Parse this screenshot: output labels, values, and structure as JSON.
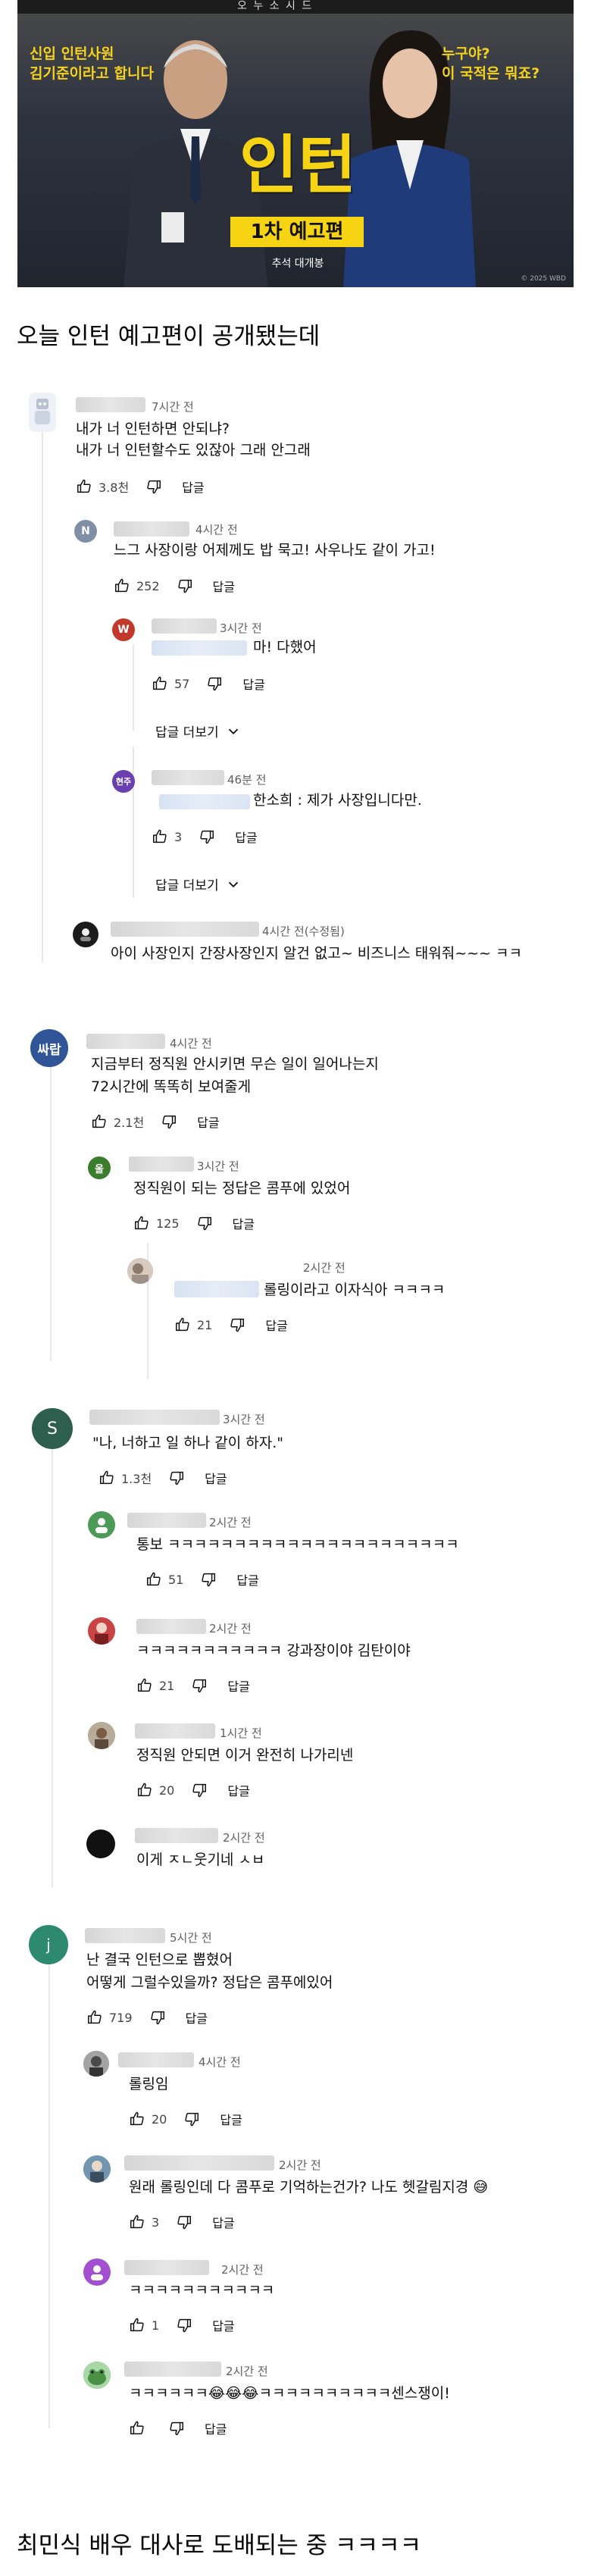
{
  "poster": {
    "top_band": "오 누 소 시 드",
    "left_text": [
      "신입 인턴사원",
      "김기준이라고 합니다"
    ],
    "right_text": [
      "누구야?",
      "이 국적은 뭐죠?"
    ],
    "title": "인턴",
    "subtitle": "1차 예고편",
    "release": "추석 대개봉",
    "mark": "© 2025 WBD"
  },
  "heading_top": "오늘 인턴 예고편이 공개됐는데",
  "heading_bottom": "최민식 배우 대사로 도배되는 중 ㅋㅋㅋㅋ",
  "comments": {
    "c1": {
      "time": "7시간 전",
      "lines": [
        "내가 너 인턴하면 안되냐?",
        "내가 너 인턴할수도 있잖아 그래 안그래"
      ],
      "likes": "3.8천",
      "reply": "답글"
    },
    "c1r1": {
      "avatar": "N",
      "time": "4시간 전",
      "lines": [
        "느그 사장이랑 어제께도 밥 묵고! 사우나도 같이 가고!"
      ],
      "likes": "252",
      "reply": "답글"
    },
    "c1r2": {
      "avatar": "W",
      "time": "3시간 전",
      "lines": [
        "마! 다했어"
      ],
      "likes": "57",
      "reply": "답글"
    },
    "c1r2_more": "답글 더보기",
    "c1r3": {
      "avatar": "현주",
      "time": "46분 전",
      "lines": [
        "한소희 : 제가 사장입니다만."
      ],
      "likes": "3",
      "reply": "답글"
    },
    "c1r3_more": "답글 더보기",
    "c1r4": {
      "time": "4시간 전(수정됨)",
      "lines": [
        "아이 사장인지 간장사장인지 알건 없고~ 비즈니스 태워줘~~~ ㅋㅋ"
      ]
    },
    "c2": {
      "avatar": "싸랍",
      "time": "4시간 전",
      "lines": [
        "지금부터 정직원 안시키면 무슨 일이 일어나는지",
        "72시간에 똑똑히 보여줄게"
      ],
      "likes": "2.1천",
      "reply": "답글"
    },
    "c2r1": {
      "avatar": "울",
      "time": "3시간 전",
      "lines": [
        "정직원이 되는 정답은 콤푸에 있었어"
      ],
      "likes": "125",
      "reply": "답글"
    },
    "c2r2": {
      "time": "2시간 전",
      "lines": [
        "롤링이라고 이자식아 ㅋㅋㅋㅋ"
      ],
      "likes": "21",
      "reply": "답글"
    },
    "c3": {
      "avatar": "S",
      "time": "3시간 전",
      "lines": [
        "\"나, 너하고 일 하나 같이 하자.\""
      ],
      "likes": "1.3천",
      "reply": "답글"
    },
    "c3r1": {
      "time": "2시간 전",
      "lines": [
        "통보 ㅋㅋㅋㅋㅋㅋㅋㅋㅋㅋㅋㅋㅋㅋㅋㅋㅋㅋㅋㅋㅋㅋ"
      ],
      "likes": "51",
      "reply": "답글"
    },
    "c3r2": {
      "time": "2시간 전",
      "lines": [
        "ㅋㅋㅋㅋㅋㅋㅋㅋㅋㅋㅋ 강과장이야 김탄이야"
      ],
      "likes": "21",
      "reply": "답글"
    },
    "c3r3": {
      "time": "1시간 전",
      "lines": [
        "정직원 안되면 이거 완전히 나가리넨"
      ],
      "likes": "20",
      "reply": "답글"
    },
    "c3r4": {
      "time": "2시간 전",
      "lines": [
        "이게 ㅈㄴ웃기네 ㅅㅂ"
      ]
    },
    "c4": {
      "avatar": "j",
      "time": "5시간 전",
      "lines": [
        "난 결국 인턴으로 뽑혔어",
        "어떻게 그럴수있을까? 정답은 콤푸에있어"
      ],
      "likes": "719",
      "reply": "답글"
    },
    "c4r1": {
      "time": "4시간 전",
      "lines": [
        "롤링임"
      ],
      "likes": "20",
      "reply": "답글"
    },
    "c4r2": {
      "time": "2시간 전",
      "lines": [
        "원래 롤링인데 다 콤푸로 기억하는건가? 나도 헷갈림지경 😅"
      ],
      "likes": "3",
      "reply": "답글"
    },
    "c4r3": {
      "time": "2시간 전",
      "lines": [
        "ㅋㅋㅋㅋㅋㅋㅋㅋㅋㅋㅋ"
      ],
      "likes": "1",
      "reply": "답글"
    },
    "c4r4": {
      "time": "2시간 전",
      "lines": [
        "ㅋㅋㅋㅋㅋㅋ😂😂😂ㅋㅋㅋㅋㅋㅋㅋㅋㅋㅋ센스쟁이!"
      ],
      "likes": "",
      "reply": "답글"
    }
  },
  "icons": {
    "like": "thumbs-up-icon",
    "dislike": "thumbs-down-icon",
    "chevron": "chevron-down-icon"
  },
  "colors": {
    "yellow": "#f6d313",
    "avatar_n": "#7f8fa6",
    "avatar_w": "#c0392b",
    "avatar_hyunju": "#6a3fb0",
    "avatar_sarab": "#2f5596",
    "avatar_ul": "#3a7d2c",
    "avatar_s": "#2e5e4e",
    "avatar_j": "#2e8a6e"
  }
}
